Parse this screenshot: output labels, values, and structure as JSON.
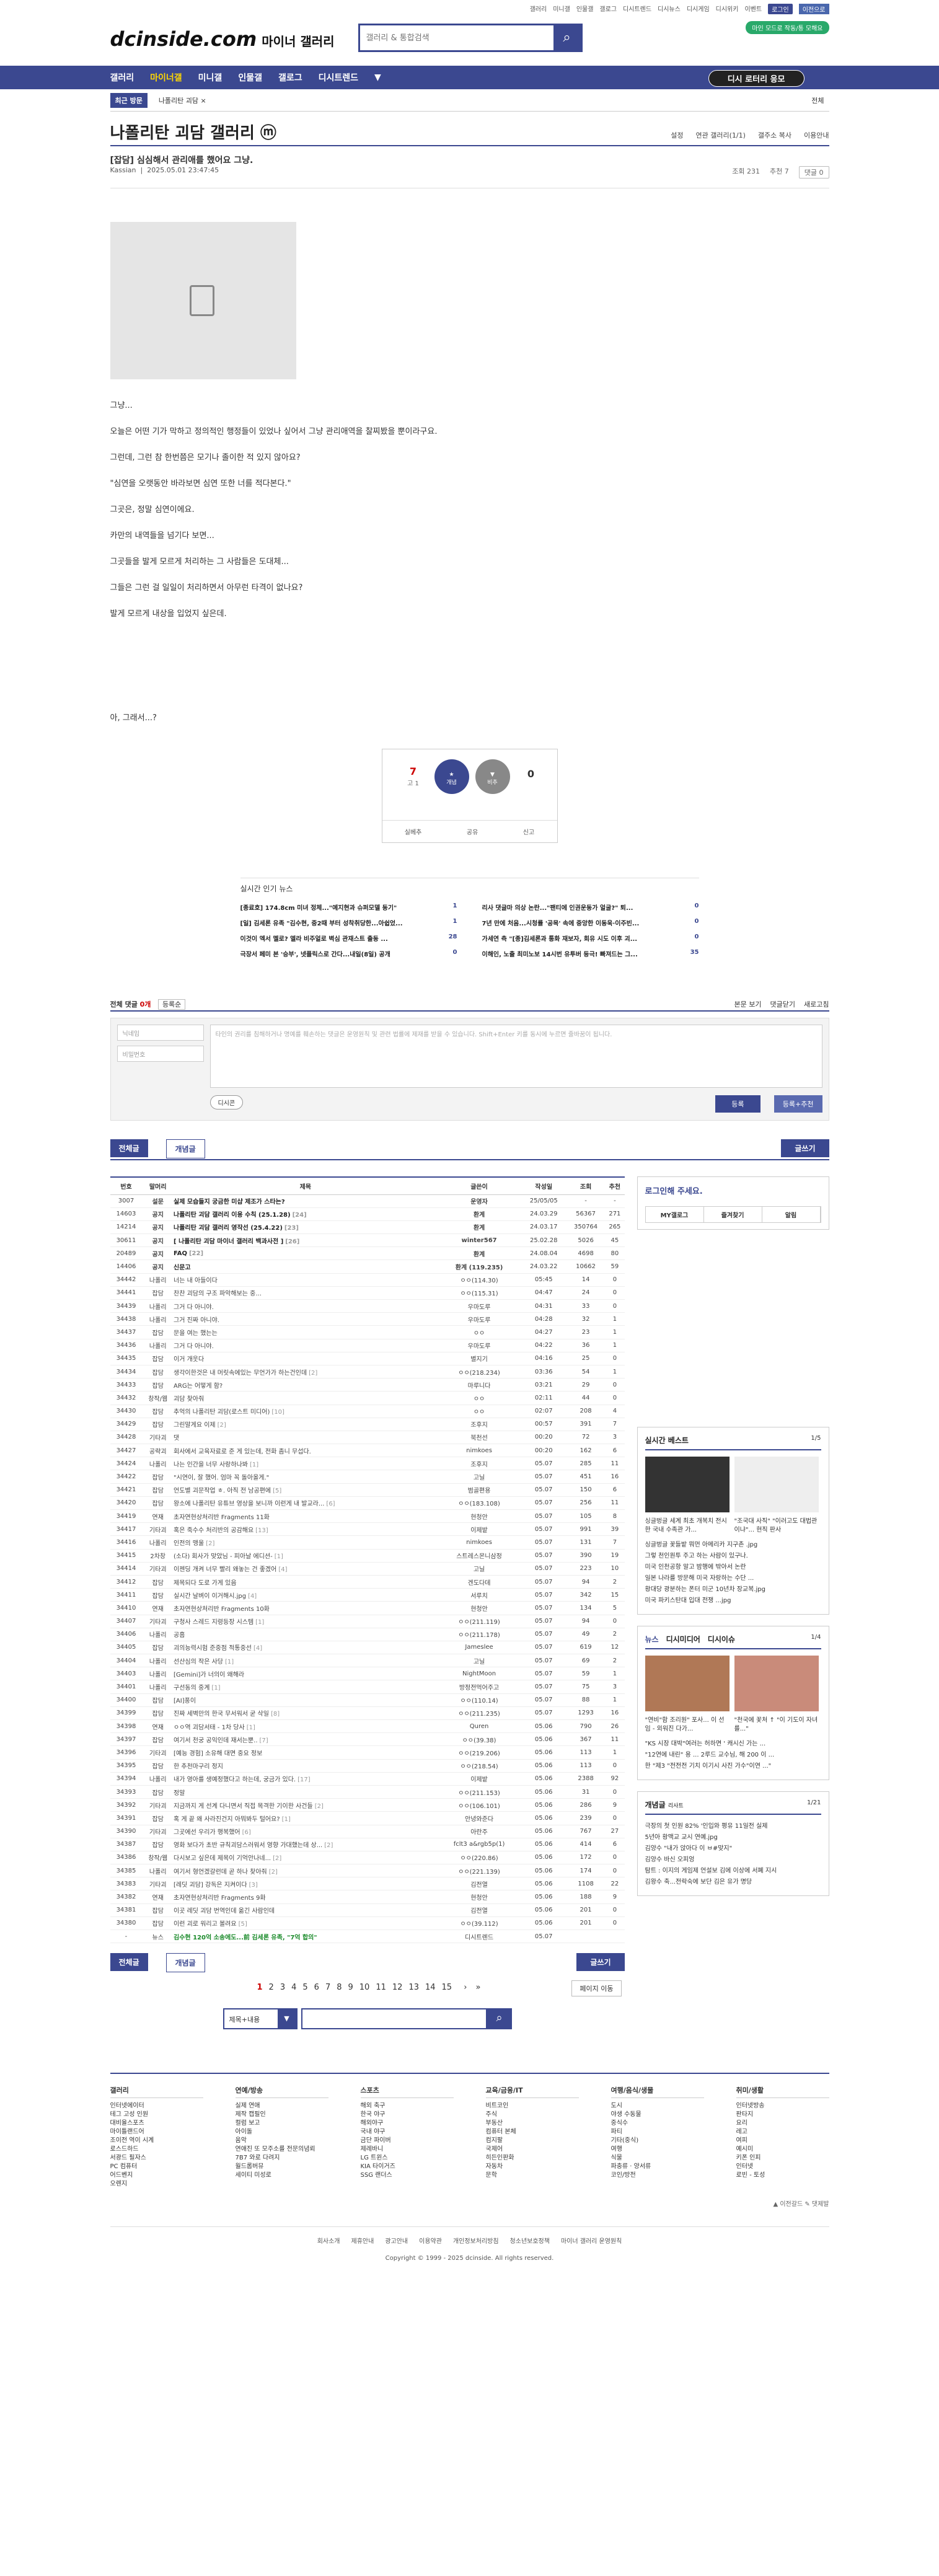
{
  "top_links": [
    "갤러리",
    "미니갤",
    "인물갤",
    "갤로그",
    "디시트렌드",
    "디시뉴스",
    "디시게임",
    "디시위키",
    "이벤트",
    "로그인",
    "이전으로"
  ],
  "site": {
    "logo": "dcinside.com",
    "sub": "마이너 갤러리",
    "search_placeholder": "갤러리 & 통합검색",
    "green_tag": "마인 모드로 작동/통 모해요"
  },
  "nav": [
    "갤러리",
    "마이너갤",
    "미니갤",
    "인물갤",
    "갤로그",
    "디시트렌드"
  ],
  "nav_btn": "디시 로터리 응모",
  "recent": {
    "label": "최근 방문",
    "item": "나폴리탄 괴담 ×",
    "all": "전체"
  },
  "gallery": {
    "title": "나폴리탄 괴담 갤러리 ⓜ",
    "opts": [
      "설정",
      "연관 갤러리(1/1)",
      "갤주소 복사",
      "이용안내"
    ]
  },
  "post": {
    "title": "[잡담] 심심해서 관리애를 했어요 그냥.",
    "writer": "Kassian",
    "date": "2025.05.01 23:47:45",
    "views": "조회 231",
    "recommend": "추천 7",
    "comments": "댓글 0",
    "lines": [
      "그냥...",
      "오늘은 어떤 기가 막하고 정의적인 행정들이 있었나 싶어서 그냥 관리애역을 찰찌봤을 뿐이라구요.",
      "그런데, 그런 참 한번쯤은 모기나 졸이한 적 있지 않아요?",
      "\"심연을 오랫동안 바라보면 심연 또한 너를 적다본다.\"",
      "그곳은, 정말 심연이에요.",
      "카만의 내역들을 넘기다 보면...",
      "그곳들을 발게 모르게 처리하는 그 사람들은 도대체...",
      "그들은 그런 걸 일일이 처리하면서 아무런 타격이 없나요?",
      "발게 모르게 내상을 입었지 싶은데.",
      "아, 그래서...?"
    ]
  },
  "vote": {
    "up": "7",
    "upsub": "고 1",
    "b1": "개념",
    "b2": "비추",
    "down": "0",
    "actions": [
      "실베추",
      "공유",
      "신고"
    ]
  },
  "hot": {
    "title": "실시간 인기 뉴스",
    "items": [
      [
        "[종료호] 174.8cm 미녀 정체...\"예지현과 슈퍼모델 동기\"",
        "1"
      ],
      [
        "리사 댓글마 의상 논란...\"팬티에 인권운동가 얼굴?\" 퇴...",
        "0"
      ],
      [
        "[일] 김세론 유족 \"김수현, 중2때 부터 성착취당한...아쉽었...",
        "1"
      ],
      [
        "7년 만에 처음...시청률 '공목' 속에 중앙한 이동욱·이주빈...",
        "0"
      ],
      [
        "이것이 엑서 멜로? 엘라 비주얼로 벽심 관재스트 출동 ...",
        "28"
      ],
      [
        "가세연 측 \"[종]김세론과 통화 재보자, 회유 시도 이후 괴...",
        "0"
      ],
      [
        "극장서 페미 본 '승부', 넷플릭스로 간다...내일(8일) 공개",
        "0"
      ],
      [
        "이해인, 노출 최미노보 14시번 유투버 등극! 빠져드는 그...",
        "35"
      ]
    ]
  },
  "comment": {
    "label": "전체 댓글",
    "count": "0개",
    "sort": "등록순",
    "right": [
      "본문 보기",
      "댓글닫기",
      "새로고침"
    ],
    "nick_ph": "닉네임",
    "pw_ph": "비밀번호",
    "ta": "타인의 권리를 침해하거나 명예를 훼손하는 댓글은 운영원칙 및 관련 법률에 제재를 받을 수 있습니다. Shift+Enter 키를 동시에 누르면 줄바꿈이 됩니다.",
    "dccon": "디시콘",
    "submit": "등록",
    "submit2": "등록+추천"
  },
  "tabs": {
    "all": "전체글",
    "concept": "개념글",
    "write": "글쓰기"
  },
  "table": {
    "headers": [
      "번호",
      "말머리",
      "제목",
      "글쓴이",
      "작성일",
      "조회",
      "추천"
    ],
    "rows": [
      [
        "3007",
        "설문",
        "실제 모습들지 궁금한 미샵 제조가 스타는?",
        "",
        "운영자",
        "25/05/05",
        "-",
        "-",
        "1"
      ],
      [
        "14603",
        "공지",
        "나폴리탄 괴담 갤러리 이용 수칙 (25.1.28)",
        "24",
        "환계",
        "24.03.29",
        "56367",
        "271",
        "1"
      ],
      [
        "14214",
        "공지",
        "나폴리탄 괴담 갤러리 영작선 (25.4.22)",
        "23",
        "환계",
        "24.03.17",
        "350764",
        "265",
        "1"
      ],
      [
        "30611",
        "공지",
        "[ 나폴리탄 괴담 마이너 갤러리 백과사전 ]",
        "26",
        "winter567",
        "25.02.28",
        "5026",
        "45",
        "1"
      ],
      [
        "20489",
        "공지",
        "FAQ",
        "22",
        "환계",
        "24.08.04",
        "4698",
        "80",
        "1"
      ],
      [
        "14406",
        "공지",
        "신문고",
        "",
        "환계 (119.235)",
        "24.03.22",
        "10662",
        "59",
        "1"
      ],
      [
        "34442",
        "나폴리",
        "너는 내 아들이다",
        "",
        "ㅇㅇ(114.30)",
        "05:45",
        "14",
        "0",
        "0"
      ],
      [
        "34441",
        "잡담",
        "찬찬 괴담의 구조 파악해보는 중...",
        "",
        "ㅇㅇ(115.31)",
        "04:47",
        "24",
        "0",
        "0"
      ],
      [
        "34439",
        "나폴리",
        "그거 다 아니야.",
        "",
        "우마도루",
        "04:31",
        "33",
        "0",
        "0"
      ],
      [
        "34438",
        "나폴리",
        "그거 진짜 아니야.",
        "",
        "우마도루",
        "04:28",
        "32",
        "1",
        "0"
      ],
      [
        "34437",
        "잡담",
        "문을 여는 했는는",
        "",
        "ㅇㅇ",
        "04:27",
        "23",
        "1",
        "0"
      ],
      [
        "34436",
        "나폴리",
        "그거 다 아니야.",
        "",
        "우마도루",
        "04:22",
        "36",
        "1",
        "0"
      ],
      [
        "34435",
        "잡담",
        "이거 개웃다",
        "",
        "별지기",
        "04:16",
        "25",
        "0",
        "0"
      ],
      [
        "34434",
        "잡담",
        "생각이한것은 내 머릿속에있는 무언가가 하는건인데",
        "2",
        "ㅇㅇ(218.234)",
        "03:36",
        "54",
        "1",
        "0"
      ],
      [
        "34433",
        "잡담",
        "ARG는 어떻게 함?",
        "",
        "마루니다",
        "03:21",
        "29",
        "0",
        "0"
      ],
      [
        "34432",
        "창작/웹",
        "괴담 찾아줘",
        "",
        "ㅇㅇ",
        "02:11",
        "44",
        "0",
        "0"
      ],
      [
        "34430",
        "잡담",
        "추억의 나폴리탄 괴담(로스트 미디어)",
        "10",
        "ㅇㅇ",
        "02:07",
        "208",
        "4",
        "0"
      ],
      [
        "34429",
        "잡담",
        "그린말게요 이제",
        "2",
        "조후지",
        "00:57",
        "391",
        "7",
        "0"
      ],
      [
        "34428",
        "기타괴",
        "댓",
        "",
        "북천선",
        "00:20",
        "72",
        "3",
        "0"
      ],
      [
        "34427",
        "공략괴",
        "회사에서 교육자료로 준 게 있는데, 전화 좀니 무섭다.",
        "",
        "nimkoes",
        "00:20",
        "162",
        "6",
        "0"
      ],
      [
        "34424",
        "나폴리",
        "나는 인간을 너무 사랑하나봐",
        "1",
        "조후지",
        "05.07",
        "285",
        "11",
        "0"
      ],
      [
        "34422",
        "잡담",
        "\"시연이, 잘 했어. 엄마 꼭 돌아올게.\"",
        "",
        "고닐",
        "05.07",
        "451",
        "16",
        "0"
      ],
      [
        "34421",
        "잡담",
        "언도별 괴문작업 ㅎ. 아직 전 남공편에",
        "5",
        "범골편용",
        "05.07",
        "150",
        "6",
        "0"
      ],
      [
        "34420",
        "잡담",
        "왕소에 나폴리탄 유튜브 영상을 보니까 이런게 내 발교라...",
        "6",
        "ㅇㅇ(183.108)",
        "05.07",
        "256",
        "11",
        "0"
      ],
      [
        "34419",
        "연재",
        "초자연현상처리반 Fragments 11화",
        "",
        "현청안",
        "05.07",
        "105",
        "8",
        "0"
      ],
      [
        "34417",
        "기타괴",
        "혹은 죽수수 처리반의 공감해요",
        "13",
        "이제밭",
        "05.07",
        "991",
        "39",
        "0"
      ],
      [
        "34416",
        "나폴리",
        "인전의 맹울",
        "2",
        "nimkoes",
        "05.07",
        "131",
        "7",
        "0"
      ],
      [
        "34415",
        "2차창",
        "(소다) 회사가 맞았님 - 피아날 에디션-",
        "1",
        "스트레스몬니삼정",
        "05.07",
        "390",
        "19",
        "0"
      ],
      [
        "34414",
        "기타괴",
        "이젠딩 개켜 너무 빨리 왜놓는 건 좋겠어",
        "4",
        "고닐",
        "05.07",
        "223",
        "10",
        "0"
      ],
      [
        "34412",
        "잡담",
        "제목되다 도로 가게 있음",
        "",
        "겐도다데",
        "05.07",
        "94",
        "2",
        "0"
      ],
      [
        "34411",
        "잡담",
        "실시간 날벼이 이거해시.jpg",
        "4",
        "서루치",
        "05.07",
        "342",
        "15",
        "0"
      ],
      [
        "34410",
        "연재",
        "초자연현상처리반 Fragments 10화",
        "",
        "현청안",
        "05.07",
        "134",
        "5",
        "0"
      ],
      [
        "34407",
        "기타괴",
        "구청사 스레드 지령등장 시스템",
        "1",
        "ㅇㅇ(211.119)",
        "05.07",
        "94",
        "0",
        "0"
      ],
      [
        "34406",
        "나폴리",
        "공흠",
        "",
        "ㅇㅇ(211.178)",
        "05.07",
        "49",
        "2",
        "0"
      ],
      [
        "34405",
        "잡담",
        "괴의능력시험 준중점 적통중선",
        "4",
        "Jameslee",
        "05.07",
        "619",
        "12",
        "0"
      ],
      [
        "34404",
        "나폴리",
        "선산심의 작은 사당",
        "1",
        "고닐",
        "05.07",
        "69",
        "2",
        "0"
      ],
      [
        "34403",
        "나폴리",
        "[Gemini]가 너의이 왜해라",
        "",
        "NightMoon",
        "05.07",
        "59",
        "1",
        "0"
      ],
      [
        "34401",
        "나폴리",
        "구선동의 중계",
        "1",
        "방정전먹어주고",
        "05.07",
        "75",
        "3",
        "0"
      ],
      [
        "34400",
        "잡담",
        "[AI]풍이",
        "",
        "ㅇㅇ(110.14)",
        "05.07",
        "88",
        "1",
        "0"
      ],
      [
        "34399",
        "잡담",
        "진짜 세벽만의 한국 무서워서 굳 삭일",
        "8",
        "ㅇㅇ(211.235)",
        "05.07",
        "1293",
        "16",
        "0"
      ],
      [
        "34398",
        "연재",
        "ㅇㅇ역 괴담서태 - 1차 당사",
        "1",
        "Quren",
        "05.06",
        "790",
        "26",
        "0"
      ],
      [
        "34397",
        "잡담",
        "여기서 천궁 공익인데 재서는뿐..",
        "7",
        "ㅇㅇ(39.38)",
        "05.06",
        "367",
        "11",
        "0"
      ],
      [
        "34396",
        "기타괴",
        "[예능 경험] 소유해 대면 중요 정보",
        "",
        "ㅇㅇ(219.206)",
        "05.06",
        "113",
        "1",
        "0"
      ],
      [
        "34395",
        "잡담",
        "한 추천마구리 정지",
        "",
        "ㅇㅇ(218.54)",
        "05.06",
        "113",
        "0",
        "0"
      ],
      [
        "34394",
        "나폴리",
        "내가 영아를 생예정했다고 하는데, 궁금가 있다.",
        "17",
        "이제밭",
        "05.06",
        "2388",
        "92",
        "0"
      ],
      [
        "34393",
        "잡담",
        "정말",
        "",
        "ㅇㅇ(211.153)",
        "05.06",
        "31",
        "0",
        "0"
      ],
      [
        "34392",
        "기타괴",
        "지금까지 게 선계 다니면서 직접 목격한 기이한 사건들",
        "2",
        "ㅇㅇ(106.101)",
        "05.06",
        "286",
        "9",
        "0"
      ],
      [
        "34391",
        "잡담",
        "혹 게 끝 왜 사라진건지 아뭐봐두 털어요?",
        "1",
        "안녕와준다",
        "05.06",
        "239",
        "0",
        "0"
      ],
      [
        "34390",
        "기타괴",
        "그곳에선 우리가 행복했어",
        "6",
        "아란주",
        "05.06",
        "767",
        "27",
        "0"
      ],
      [
        "34387",
        "잡담",
        "영화 보다가 초반 규칙괴담스러워서 영향 가대했는데 상...",
        "2",
        "fclt3 a&rgb5p(1)",
        "05.06",
        "414",
        "6",
        "0"
      ],
      [
        "34386",
        "창작/웹",
        "다시보고 싶은데 제목이 기억안나네...",
        "2",
        "ㅇㅇ(220.86)",
        "05.06",
        "172",
        "0",
        "0"
      ],
      [
        "34385",
        "나폴리",
        "여기서 형언겠갈런데 곧 하나 찾아줘",
        "2",
        "ㅇㅇ(221.139)",
        "05.06",
        "174",
        "0",
        "0"
      ],
      [
        "34383",
        "기타괴",
        "[레딧 괴담] 강독은 지켜이다",
        "3",
        "김전열",
        "05.06",
        "1108",
        "22",
        "0"
      ],
      [
        "34382",
        "연재",
        "초자연현상처리반 Fragments 9화",
        "",
        "현청안",
        "05.06",
        "188",
        "9",
        "0"
      ],
      [
        "34381",
        "잡담",
        "이곳 레딧 괴담 번역인데 옮긴 사람인데",
        "",
        "김전열",
        "05.06",
        "201",
        "0",
        "0"
      ],
      [
        "34380",
        "잡담",
        "이런 괴로 워리고 볼려요",
        "5",
        "ㅇㅇ(39.112)",
        "05.06",
        "201",
        "0",
        "0"
      ],
      [
        "-",
        "뉴스",
        "김수현 120억 소송에도...前 김세론 유족, \"7억 합의\"",
        "",
        "디시트렌드",
        "05.07",
        "",
        "",
        ""
      ]
    ]
  },
  "pager": {
    "pages": [
      "1",
      "2",
      "3",
      "4",
      "5",
      "6",
      "7",
      "8",
      "9",
      "10",
      "11",
      "12",
      "13",
      "14",
      "15"
    ],
    "next": "›",
    "last": "»",
    "move": "페이지 이동"
  },
  "bsearch": {
    "sel": "제목+내용",
    "btn": "⌕"
  },
  "side": {
    "login": "로그인해 주세요.",
    "login_btns": [
      "MY갤로그",
      "즐겨찾기",
      "알림"
    ],
    "best": {
      "title": "실시간 베스트",
      "page": "1/5",
      "caps": [
        "싱글벙글 세계 최초 개복치 전시한 국내 수족관 가...",
        "\"조국대 사직\" \"이러고도 대법관이냐\"... 현직 판사"
      ],
      "list": [
        "싱글벙글 꽃들밭 뭐먼 아메리카 지구촌 .jpg",
        "그렇 천인원투 주고 하는 사람이 있구나.",
        "미국 인천공항 알고 밤행에 밖아서 논란",
        "일본 나라를 방문해 미국 자랑하는 수단 ...",
        "황대당 광분하는 폰터 미군 10년차 장교복.jpg",
        "미국 파키스탄대 입대 전쟁 ...jpg"
      ]
    },
    "news": {
      "tabs": [
        "뉴스",
        "디시미디어",
        "디시이슈"
      ],
      "page": "1/4",
      "caps": [
        "\"연비\"함 조리원\" 포사... 이 선임 - 외워진 다가...",
        "\"천국에 꽃처 ↑ \"이 기도이 자녀를...\""
      ],
      "list": [
        "\"KS 시장 대박\"여러는 허하면 ' 캐시신 가는 ... ",
        "\"12연에 내린\" 용 ... 2루드 교수님, 해 200 이 ...",
        "한 \"제3 \"전전전 기치 이기시 사진 가수\"이연 ...\""
      ]
    },
    "concept": {
      "title": "개념글",
      "sub": "리사트",
      "page": "1/21",
      "list": [
        "극장의 첫 인원 82% '인입와 평유 11일전 실제",
        "5년아 황맥교 교시 연예.jpg",
        "김양수 \"내가 앉아다 이 ㅂ#맞지\"",
        "김양수 바신 오피엉",
        "탐트 : 이지의 게임제 언설보 김에 이상에 서폐 지시",
        "김왕수 축...전락숙에 보단 김은 유가 명당"
      ]
    }
  },
  "footer": {
    "cols": [
      {
        "h": "갤러리",
        "items": [
          "인터넷에이터",
          "테그 고성 인원",
          "대비율스포츠",
          "마이틀랜드어",
          "조이전 역이 시계",
          "로스드하드",
          "서광드 필자스",
          "PC 컴퓨터",
          "어드벤지",
          "오렌지"
        ]
      },
      {
        "h": "연예/방송",
        "items": [
          "실제 연애",
          "제작 캡필인",
          "컬럼 보고",
          "아이돌",
          "움악",
          "연애진 또 모주소를 전문의념뢰",
          "7B7 와로 다려지",
          "월드롭버뮤",
          "세이티 미성로"
        ]
      },
      {
        "h": "스포츠",
        "items": [
          "해외 축구",
          "한국 야구",
          "해외야구",
          "국내 야구",
          "금단 파이버",
          "제레바니",
          "LG 트윈스",
          "KIA 타이거즈",
          "SSG 랜더스"
        ]
      },
      {
        "h": "교육/금융/IT",
        "items": [
          "비트코인",
          "주식",
          "부동산",
          "컴퓨터 본체",
          "컴지팔",
          "국제어",
          "히든인판화",
          "자동차",
          "문학"
        ]
      },
      {
        "h": "여행/음식/생물",
        "items": [
          "도시",
          "야생 수동물",
          "중식수",
          "파티",
          "기타(중식)",
          "여행",
          "식물",
          "파충류 · 양서류",
          "코인/방전"
        ]
      },
      {
        "h": "취미/생활",
        "items": [
          "인터넷방송",
          "판타지",
          "요리",
          "레고",
          "여피",
          "예시미",
          "키폰 인피",
          "인터넷",
          "로빈 - 토성"
        ]
      }
    ],
    "links": [
      "회사소개",
      "제휴안내",
      "광고안내",
      "이용약관",
      "개인정보처리방침",
      "청소년보호정책",
      "마이너 갤러리 운영원칙"
    ],
    "copyright": "Copyright © 1999 - 2025 dcinside. All rights reserved.",
    "meta": "▲ 이전갈드   ✎ 댓제발"
  }
}
